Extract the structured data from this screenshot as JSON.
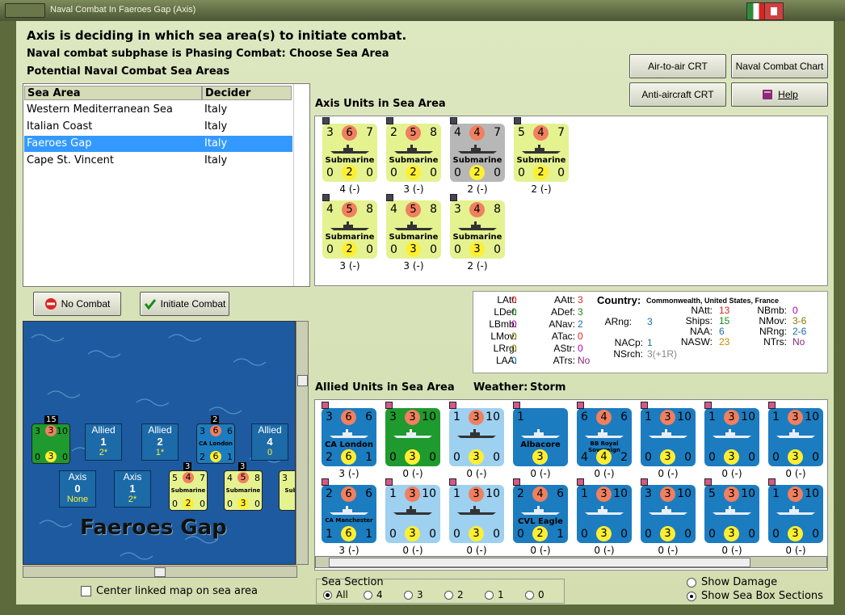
{
  "window": {
    "title": "Naval Combat In Faeroes Gap (Axis)"
  },
  "header": {
    "line1": "Axis is deciding in which sea area(s) to initiate combat.",
    "line2": "Naval combat subphase is Phasing Combat: Choose Sea Area",
    "line3": "Potential Naval Combat Sea Areas"
  },
  "buttons": {
    "air_to_air": "Air-to-air CRT",
    "naval_chart": "Naval Combat Chart",
    "anti_aircraft": "Anti-aircraft CRT",
    "help": "Help",
    "no_combat": "No Combat",
    "initiate_combat": "Initiate Combat"
  },
  "sea_table": {
    "columns": [
      "Sea Area",
      "Decider"
    ],
    "rows": [
      {
        "area": "Western Mediterranean Sea",
        "decider": "Italy"
      },
      {
        "area": "Italian Coast",
        "decider": "Italy"
      },
      {
        "area": "Faeroes Gap",
        "decider": "Italy"
      },
      {
        "area": "Cape St. Vincent",
        "decider": "Italy"
      }
    ],
    "selected_index": 2
  },
  "axis_units": {
    "title": "Axis Units in Sea Area",
    "units": [
      {
        "tl": "3",
        "tc": "6",
        "tr": "7",
        "name": "Submarine",
        "bl": "0",
        "bc": "2",
        "br": "0",
        "footer": "4 (-)",
        "color": "#e4f290"
      },
      {
        "tl": "2",
        "tc": "5",
        "tr": "8",
        "name": "Submarine",
        "bl": "0",
        "bc": "2",
        "br": "0",
        "footer": "3 (-)",
        "color": "#e4f290"
      },
      {
        "tl": "4",
        "tc": "4",
        "tr": "7",
        "name": "Submarine",
        "bl": "0",
        "bc": "2",
        "br": "0",
        "footer": "2 (-)",
        "color": "#b7b7b7"
      },
      {
        "tl": "5",
        "tc": "4",
        "tr": "7",
        "name": "Submarine",
        "bl": "0",
        "bc": "2",
        "br": "0",
        "footer": "2 (-)",
        "color": "#e4f290"
      },
      {
        "tl": "4",
        "tc": "5",
        "tr": "8",
        "name": "Submarine",
        "bl": "0",
        "bc": "2",
        "br": "0",
        "footer": "3 (-)",
        "color": "#e4f290"
      },
      {
        "tl": "4",
        "tc": "5",
        "tr": "8",
        "name": "Submarine",
        "bl": "0",
        "bc": "3",
        "br": "0",
        "footer": "3 (-)",
        "color": "#e4f290"
      },
      {
        "tl": "3",
        "tc": "4",
        "tr": "8",
        "name": "Submarine",
        "bl": "0",
        "bc": "3",
        "br": "0",
        "footer": "2 (-)",
        "color": "#e4f290"
      }
    ]
  },
  "stats": {
    "LAtt": "0",
    "LDef": "0",
    "LBmb": "0",
    "LMov": "0",
    "LRrg": "0",
    "LAA": "0",
    "AAtt": "3",
    "ADef": "3",
    "ANav": "2",
    "ATac": "0",
    "AStr": "0",
    "ATrs": "No",
    "country_label": "Country:",
    "country_value": "Commonwealth, United States, France",
    "ARng": "3",
    "NACp": "1",
    "NSrch": "3(+1R)",
    "NAtt": "13",
    "Ships": "15",
    "NAA": "6",
    "NASW": "23",
    "NBmb": "0",
    "NMov": "3-6",
    "NRng": "2-6",
    "NTrs": "No"
  },
  "allied_units": {
    "title": "Allied Units in Sea Area",
    "weather_label": "Weather:",
    "weather_value": "Storm",
    "units": [
      {
        "tl": "3",
        "tc": "6",
        "tr": "6",
        "name": "CA London",
        "bl": "2",
        "bc": "6",
        "br": "1",
        "footer": "3 (-)",
        "color": "#1c7cc0",
        "kind": "named"
      },
      {
        "tl": "3",
        "tc": "3",
        "tr": "10",
        "name": "",
        "bl": "0",
        "bc": "3",
        "br": "0",
        "footer": "0 (-)",
        "color": "#1f9a2e",
        "kind": "fleet"
      },
      {
        "tl": "1",
        "tc": "3",
        "tr": "10",
        "name": "",
        "bl": "0",
        "bc": "3",
        "br": "0",
        "footer": "0 (-)",
        "color": "#9ed0f0",
        "kind": "fleet"
      },
      {
        "tl": "1",
        "tc": "",
        "tr": "",
        "name": "Albacore",
        "bl": "",
        "bc": "3",
        "br": "",
        "footer": "0 (-)",
        "color": "#1c7cc0",
        "kind": "plane"
      },
      {
        "tl": "6",
        "tc": "4",
        "tr": "6",
        "name": "BB Royal Sovereign",
        "bl": "4",
        "bc": "4",
        "br": "2",
        "footer": "0 (-)",
        "color": "#1c7cc0",
        "kind": "named"
      },
      {
        "tl": "1",
        "tc": "3",
        "tr": "10",
        "name": "",
        "bl": "0",
        "bc": "3",
        "br": "0",
        "footer": "0 (-)",
        "color": "#1c7cc0",
        "kind": "fleet"
      },
      {
        "tl": "1",
        "tc": "3",
        "tr": "10",
        "name": "",
        "bl": "0",
        "bc": "3",
        "br": "0",
        "footer": "0 (-)",
        "color": "#1c7cc0",
        "kind": "fleet"
      },
      {
        "tl": "1",
        "tc": "3",
        "tr": "10",
        "name": "",
        "bl": "0",
        "bc": "3",
        "br": "0",
        "footer": "0 (-)",
        "color": "#1c7cc0",
        "kind": "fleet"
      },
      {
        "tl": "2",
        "tc": "6",
        "tr": "6",
        "name": "CA Manchester",
        "bl": "1",
        "bc": "6",
        "br": "1",
        "footer": "3 (-)",
        "color": "#1c7cc0",
        "kind": "named"
      },
      {
        "tl": "1",
        "tc": "3",
        "tr": "10",
        "name": "",
        "bl": "0",
        "bc": "3",
        "br": "0",
        "footer": "0 (-)",
        "color": "#9ed0f0",
        "kind": "fleet"
      },
      {
        "tl": "1",
        "tc": "3",
        "tr": "10",
        "name": "",
        "bl": "0",
        "bc": "3",
        "br": "0",
        "footer": "0 (-)",
        "color": "#9ed0f0",
        "kind": "fleet"
      },
      {
        "tl": "2",
        "tc": "4",
        "tr": "6",
        "name": "CVL Eagle",
        "bl": "0",
        "bc": "2",
        "br": "1",
        "footer": "0 (-)",
        "color": "#1c7cc0",
        "kind": "named"
      },
      {
        "tl": "1",
        "tc": "3",
        "tr": "10",
        "name": "",
        "bl": "0",
        "bc": "3",
        "br": "0",
        "footer": "0 (-)",
        "color": "#1c7cc0",
        "kind": "fleet"
      },
      {
        "tl": "3",
        "tc": "3",
        "tr": "10",
        "name": "",
        "bl": "0",
        "bc": "3",
        "br": "0",
        "footer": "0 (-)",
        "color": "#1c7cc0",
        "kind": "fleet"
      },
      {
        "tl": "5",
        "tc": "3",
        "tr": "10",
        "name": "",
        "bl": "0",
        "bc": "3",
        "br": "0",
        "footer": "0 (-)",
        "color": "#1c7cc0",
        "kind": "fleet"
      },
      {
        "tl": "1",
        "tc": "3",
        "tr": "10",
        "name": "",
        "bl": "0",
        "bc": "3",
        "br": "0",
        "footer": "0 (-)",
        "color": "#1c7cc0",
        "kind": "fleet"
      }
    ]
  },
  "map": {
    "sea_name": "Faeroes Gap",
    "boxes": [
      {
        "side": "Allied",
        "value": "1",
        "sub": "2*"
      },
      {
        "side": "Allied",
        "value": "2",
        "sub": "1*"
      },
      {
        "side": "Allied",
        "value": "4",
        "sub": "0"
      },
      {
        "side": "Axis",
        "value": "0",
        "sub": "None"
      },
      {
        "side": "Axis",
        "value": "1",
        "sub": "2*"
      }
    ],
    "stack_counts": [
      "15",
      "2",
      "3",
      "3"
    ],
    "mini_units": [
      {
        "tl": "3",
        "tc": "3",
        "tr": "10",
        "bl": "0",
        "bc": "3",
        "br": "0",
        "name": ""
      },
      {
        "tl": "3",
        "tc": "6",
        "tr": "6",
        "bl": "2",
        "bc": "6",
        "br": "1",
        "name": "CA London"
      },
      {
        "tl": "5",
        "tc": "4",
        "tr": "7",
        "bl": "0",
        "bc": "2",
        "br": "0",
        "name": "Submarine"
      },
      {
        "tl": "4",
        "tc": "5",
        "tr": "8",
        "bl": "0",
        "bc": "3",
        "br": "0",
        "name": "Submarine"
      },
      {
        "tl": "3",
        "tc": "",
        "tr": "",
        "bl": "",
        "bc": "",
        "br": "",
        "name": "Submari"
      }
    ]
  },
  "center_linked": {
    "label": "Center linked map on sea area",
    "checked": false
  },
  "sea_section": {
    "title": "Sea Section",
    "options": [
      "All",
      "4",
      "3",
      "2",
      "1",
      "0"
    ],
    "selected": "All"
  },
  "display_options": {
    "show_damage": "Show Damage",
    "show_sea_box": "Show Sea Box Sections",
    "selected": "show_sea_box"
  }
}
